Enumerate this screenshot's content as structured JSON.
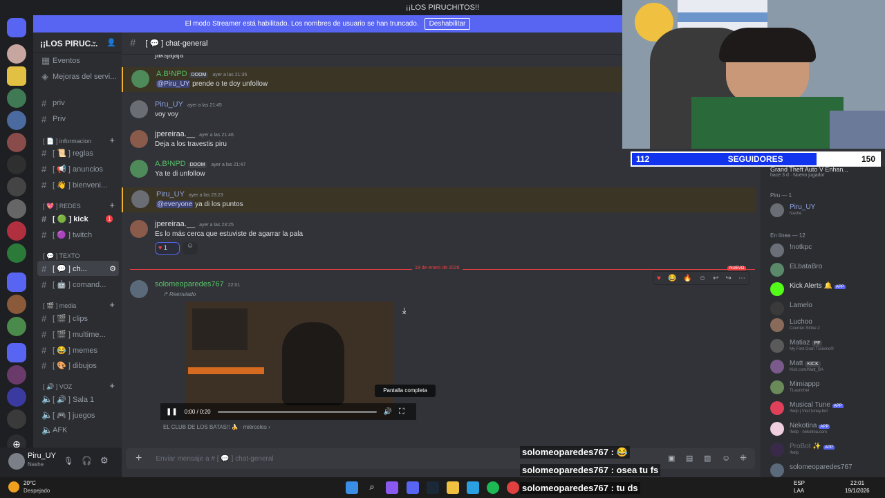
{
  "window": {
    "title": "¡¡LOS PIRUCHITOS!!"
  },
  "banner": {
    "text": "El modo Streamer está habilitado. Los nombres de usuario se han truncado.",
    "button": "Deshabilitar"
  },
  "guild": {
    "name": "¡¡LOS PIRUC..."
  },
  "sidebar": {
    "top": [
      "Eventos",
      "Mejoras del servi..."
    ],
    "plain": [
      "priv",
      "Priv"
    ],
    "cat_info": "[ 📄 ] informacion",
    "info": [
      "[ 📜 ] reglas",
      "[ 📢 ] anuncios",
      "[ 👋 ] bienveni..."
    ],
    "cat_redes": "[ 💖 ] REDES",
    "redes": [
      "[ 🟢 ] kick",
      "[ 🟣 ] twitch"
    ],
    "kick_badge": "1",
    "cat_texto": "[ 💬 ] TEXTO",
    "texto": [
      "[ 💬 ] ch...",
      "[ 🤖 ] comand..."
    ],
    "cat_media": "[ 🎬 ] media",
    "media": [
      "[ 🎬 ] clips",
      "[ 🎬 ] multime...",
      "[ 😂 ] memes",
      "[ 🎨 ] dibujos"
    ],
    "cat_voz": "[ 🔊 ] VOZ",
    "voz": [
      "[ 🔊 ] Sala 1",
      "[ 🎮 ] juegos",
      "AFK"
    ]
  },
  "user": {
    "name": "Piru_UY",
    "status": "Nashe"
  },
  "channel": {
    "name": "[ 💬 ] chat-general"
  },
  "messages": [
    {
      "text": "jaksjajaja"
    },
    {
      "user": "A.B¹NPD",
      "tag": "DOOM",
      "time": "ayer a las 21:35",
      "mention": "@Piru_UY",
      "text": " prende o te doy unfollow"
    },
    {
      "user": "Piru_UY",
      "time": "ayer a las 21:45",
      "text": "voy voy"
    },
    {
      "user": "jpereiraa.__",
      "time": "ayer a las 21:46",
      "text": "Deja a los travestis piru"
    },
    {
      "user": "A.B¹NPD",
      "tag": "DOOM",
      "time": "ayer a las 21:47",
      "text": "Ya te di unfollow"
    },
    {
      "user": "Piru_UY",
      "time": "ayer a las 23:23",
      "mention": "@everyone",
      "text": " ya di los puntos"
    },
    {
      "user": "jpereiraa.__",
      "time": "ayer a las 23:25",
      "text": "Es lo más cerca que estuviste de agarrar la pala",
      "reaction": "1"
    },
    {
      "user": "solomeoparedes767",
      "time": "22:01",
      "forwarded": "Reenviado",
      "source": "EL CLUB DE LOS BATAS!! 🍌",
      "source_time": "miércoles"
    }
  ],
  "date_separator": "19 de enero de 2026",
  "new_label": "NUEVO",
  "video": {
    "time": "0:00 / 0:20",
    "tooltip": "Pantalla completa",
    "progress": 0
  },
  "composer": {
    "placeholder": "Enviar mensaje a # [ 💬 ] chat-general"
  },
  "follow_goal": {
    "current": "112",
    "label": "SEGUIDORES",
    "goal": "150",
    "fraction": 0.747
  },
  "activity": {
    "game": "Grand Theft Auto V Enhan...",
    "meta": "hace 3 d · Nuevo jugador"
  },
  "members": {
    "group_piru": "Piru — 1",
    "piru": {
      "name": "Piru_UY",
      "sub": "Nashe"
    },
    "group_online": "En línea — 12",
    "online": [
      {
        "name": "!notkpc",
        "sub": ""
      },
      {
        "name": "ELbataBro",
        "sub": ""
      },
      {
        "name": "Kick Alerts 🔔",
        "sub": "",
        "badge": "APP"
      },
      {
        "name": "Lamelo",
        "sub": ""
      },
      {
        "name": "Luchoo",
        "sub": "Counter-Strike 2"
      },
      {
        "name": "Matiaz",
        "sub": "My First Gran Turismo®",
        "tag": "PF"
      },
      {
        "name": "Matt",
        "sub": "Kick.com/Matt_BA",
        "tag": "KICK"
      },
      {
        "name": "Mimiappp",
        "sub": "TLauncher"
      },
      {
        "name": "Musical Tune",
        "sub": "/help | Visit tuney.bot",
        "badge": "APP"
      },
      {
        "name": "Nekotina",
        "sub": "!help · nekotina.com",
        "badge": "APP"
      },
      {
        "name": "ProBot ✨",
        "sub": "/help",
        "badge": "APP"
      },
      {
        "name": "solomeoparedes767",
        "sub": ""
      }
    ]
  },
  "stream_chat": [
    {
      "user": "solomeoparedes767",
      "text": " : 😂"
    },
    {
      "user": "solomeoparedes767",
      "text": " : osea tu fs"
    },
    {
      "user": "solomeoparedes767",
      "text": " : tu ds"
    }
  ],
  "taskbar": {
    "weather_temp": "20°C",
    "weather_text": "Despejado",
    "lang": "ESP",
    "lang2": "LAA",
    "time": "22:01",
    "date": "19/1/2026"
  }
}
